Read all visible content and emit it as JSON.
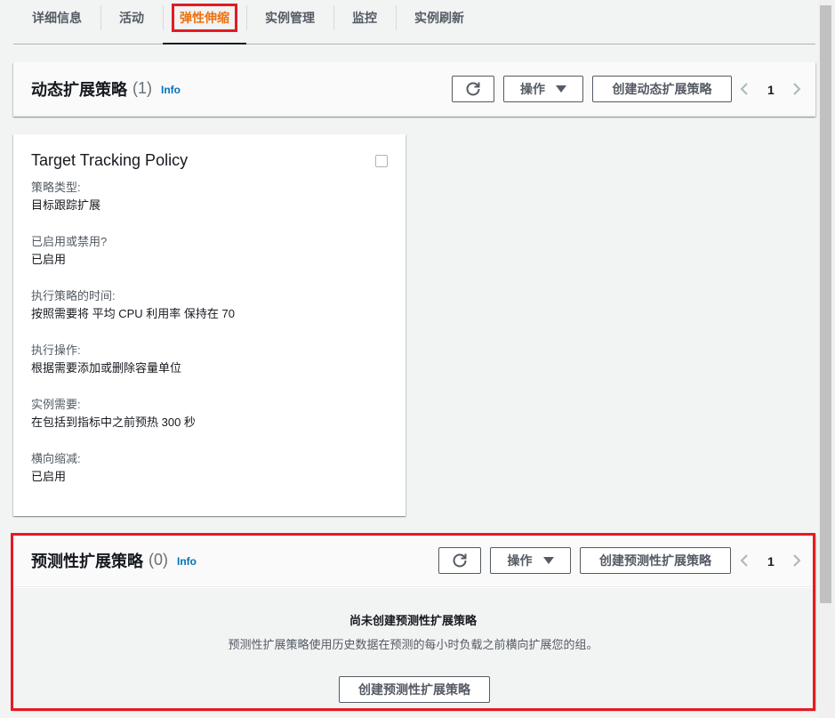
{
  "tabs": [
    "详细信息",
    "活动",
    "弹性伸缩",
    "实例管理",
    "监控",
    "实例刷新"
  ],
  "dynamic": {
    "title": "动态扩展策略",
    "count": "(1)",
    "info": "Info",
    "actions_label": "操作",
    "create_label": "创建动态扩展策略",
    "page": "1"
  },
  "policy_card": {
    "title": "Target Tracking Policy",
    "fields": [
      {
        "label": "策略类型:",
        "value": "目标跟踪扩展"
      },
      {
        "label": "已启用或禁用?",
        "value": "已启用"
      },
      {
        "label": "执行策略的时间:",
        "value": "按照需要将 平均 CPU 利用率 保持在 70"
      },
      {
        "label": "执行操作:",
        "value": "根据需要添加或删除容量单位"
      },
      {
        "label": "实例需要:",
        "value": "在包括到指标中之前预热 300 秒"
      },
      {
        "label": "横向缩减:",
        "value": "已启用"
      }
    ]
  },
  "predictive": {
    "title": "预测性扩展策略",
    "count": "(0)",
    "info": "Info",
    "actions_label": "操作",
    "create_label": "创建预测性扩展策略",
    "page": "1",
    "empty_title": "尚未创建预测性扩展策略",
    "empty_desc": "预测性扩展策略使用历史数据在预测的每小时负载之前横向扩展您的组。",
    "empty_button": "创建预测性扩展策略"
  }
}
